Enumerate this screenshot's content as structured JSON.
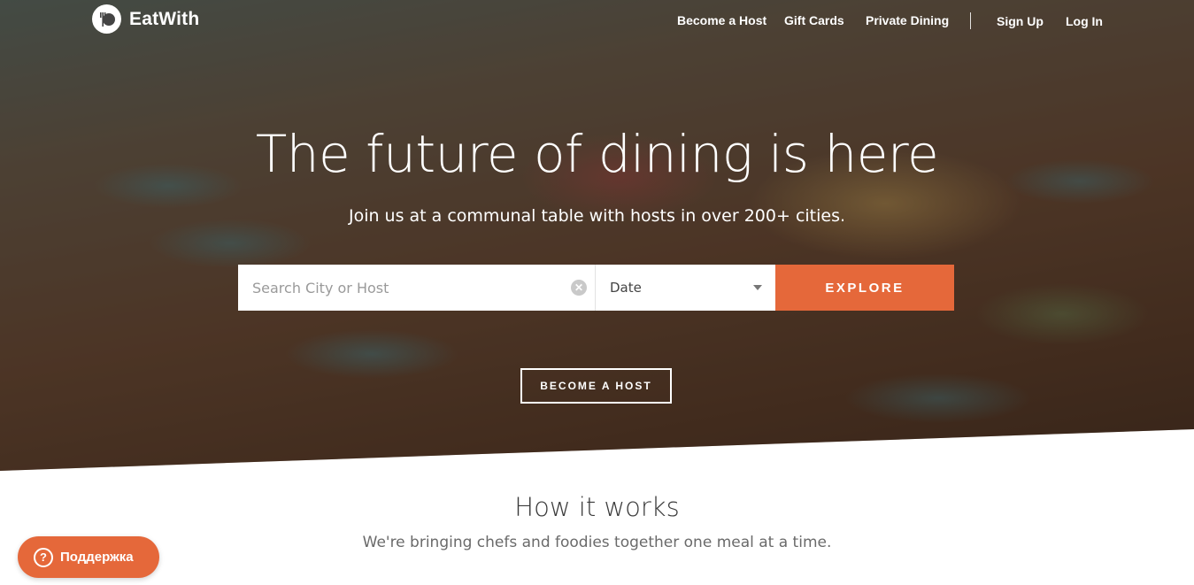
{
  "brand": {
    "name": "EatWith",
    "icon": "fork-plate-icon"
  },
  "nav": {
    "become_host": "Become a Host",
    "gift_cards": "Gift Cards",
    "private_dining": "Private Dining",
    "sign_up": "Sign Up",
    "log_in": "Log In"
  },
  "hero": {
    "headline": "The future of dining is here",
    "subhead": "Join us at a communal table with hosts in over 200+ cities."
  },
  "search": {
    "placeholder": "Search City or Host",
    "value": "",
    "date_label": "Date",
    "explore_label": "EXPLORE"
  },
  "host_button": {
    "label": "BECOME A HOST"
  },
  "how_it_works": {
    "title": "How it works",
    "subtitle": "We're bringing chefs and foodies together one meal at a time."
  },
  "support": {
    "label": "Поддержка",
    "icon": "question-icon",
    "icon_glyph": "?"
  },
  "colors": {
    "accent": "#e5683a",
    "text_dark": "#3a3a3a",
    "text_muted": "#6a6a6a"
  }
}
